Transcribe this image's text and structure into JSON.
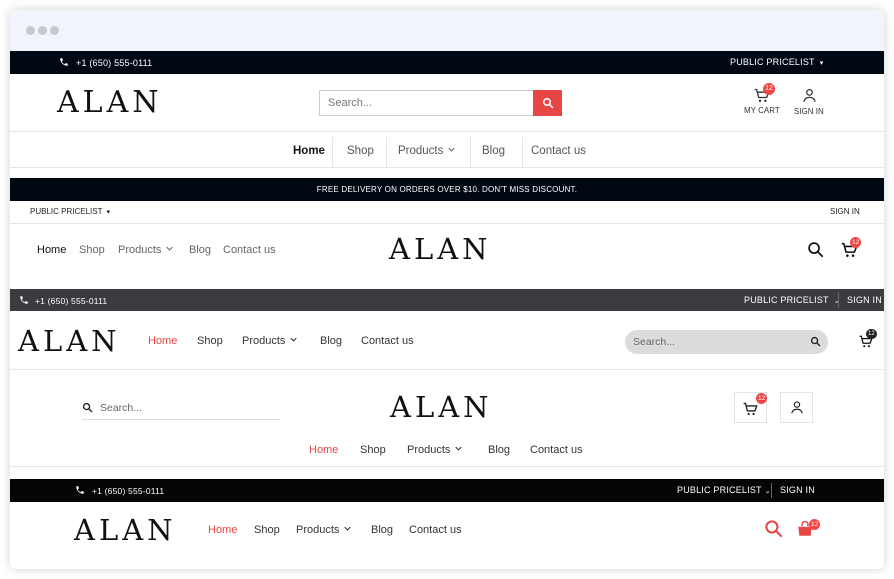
{
  "colors": {
    "accent": "#e84545",
    "dark_bar": "#000814",
    "gray_bar": "#3a3c3f",
    "black_bar": "#050505"
  },
  "brand": {
    "logo": "ALAN"
  },
  "common": {
    "phone": "+1 (650) 555-0111",
    "pricelist": "PUBLIC PRICELIST",
    "sign_in_upper": "SIGN IN",
    "cart_count": "12",
    "search_placeholder": "Search...",
    "nav": {
      "home": "Home",
      "shop": "Shop",
      "products": "Products",
      "blog": "Blog",
      "contact": "Contact us"
    }
  },
  "header1": {
    "my_cart": "MY CART",
    "sign_in": "SIGN IN"
  },
  "header2": {
    "promo": "FREE DELIVERY ON ORDERS OVER $10. DON'T MISS DISCOUNT."
  },
  "icons": [
    "phone-icon",
    "caret-down-icon",
    "search-icon",
    "cart-icon",
    "user-icon",
    "shopping-bag-icon",
    "chevron-down-icon"
  ]
}
